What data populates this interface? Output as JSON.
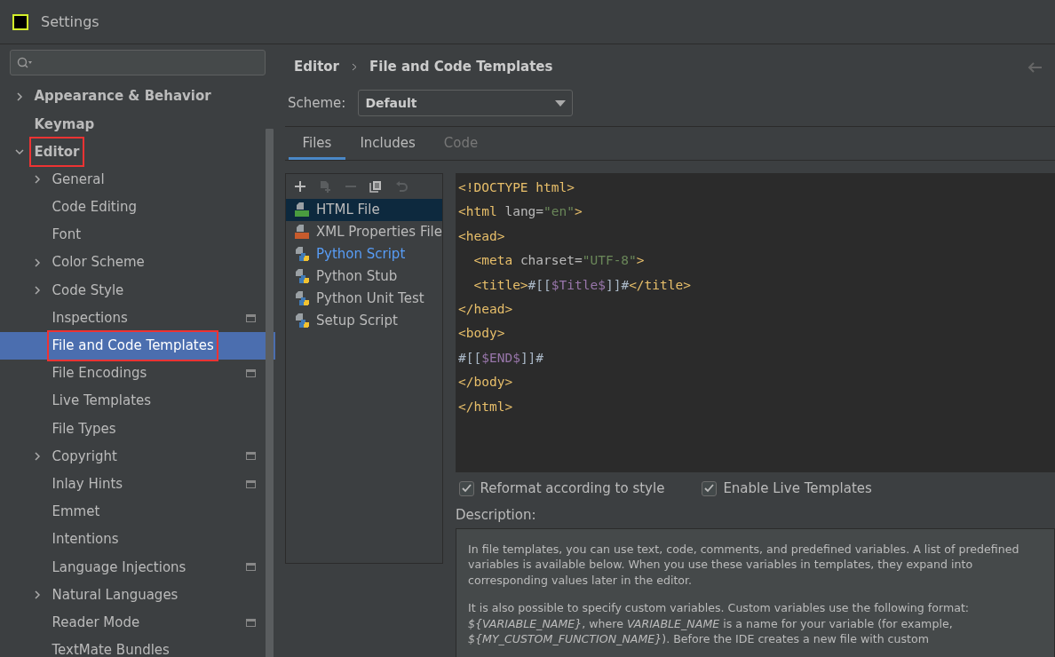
{
  "window": {
    "title": "Settings"
  },
  "sidebar": {
    "items": [
      {
        "label": "Appearance & Behavior",
        "expandable": true,
        "expanded": false,
        "selected": false,
        "highlighted": false
      },
      {
        "label": "Keymap",
        "selected": false,
        "highlighted": false
      },
      {
        "label": "Editor",
        "expandable": true,
        "expanded": true,
        "selected": false,
        "highlighted": true,
        "children": [
          {
            "label": "General",
            "expandable": true,
            "expanded": false,
            "selected": false,
            "highlighted": false
          },
          {
            "label": "Code Editing",
            "selected": false,
            "highlighted": false
          },
          {
            "label": "Font",
            "selected": false,
            "highlighted": false
          },
          {
            "label": "Color Scheme",
            "expandable": true,
            "expanded": false,
            "selected": false,
            "highlighted": false
          },
          {
            "label": "Code Style",
            "expandable": true,
            "expanded": false,
            "selected": false,
            "highlighted": false
          },
          {
            "label": "Inspections",
            "selected": false,
            "highlighted": false,
            "project_scope": true
          },
          {
            "label": "File and Code Templates",
            "selected": true,
            "highlighted": true
          },
          {
            "label": "File Encodings",
            "selected": false,
            "highlighted": false,
            "project_scope": true
          },
          {
            "label": "Live Templates",
            "selected": false,
            "highlighted": false
          },
          {
            "label": "File Types",
            "selected": false,
            "highlighted": false
          },
          {
            "label": "Copyright",
            "expandable": true,
            "expanded": false,
            "selected": false,
            "highlighted": false,
            "project_scope": true
          },
          {
            "label": "Inlay Hints",
            "selected": false,
            "highlighted": false,
            "project_scope": true
          },
          {
            "label": "Emmet",
            "selected": false,
            "highlighted": false
          },
          {
            "label": "Intentions",
            "selected": false,
            "highlighted": false
          },
          {
            "label": "Language Injections",
            "selected": false,
            "highlighted": false,
            "project_scope": true
          },
          {
            "label": "Natural Languages",
            "expandable": true,
            "expanded": false,
            "selected": false,
            "highlighted": false
          },
          {
            "label": "Reader Mode",
            "selected": false,
            "highlighted": false,
            "project_scope": true
          },
          {
            "label": "TextMate Bundles",
            "selected": false,
            "highlighted": false
          }
        ]
      }
    ]
  },
  "breadcrumb": [
    "Editor",
    "File and Code Templates"
  ],
  "scheme": {
    "label": "Scheme:",
    "value": "Default"
  },
  "tabs": [
    {
      "label": "Files",
      "selected": true,
      "disabled": false
    },
    {
      "label": "Includes",
      "selected": false,
      "disabled": false
    },
    {
      "label": "Code",
      "selected": false,
      "disabled": true
    }
  ],
  "toolbar": [
    {
      "kind": "add",
      "disabled": false
    },
    {
      "kind": "add-child",
      "disabled": true
    },
    {
      "kind": "remove",
      "disabled": true
    },
    {
      "kind": "copy",
      "disabled": false
    },
    {
      "kind": "reset",
      "disabled": true
    }
  ],
  "templates": [
    {
      "label": "HTML File",
      "kind": "html",
      "selected": true,
      "modified": false
    },
    {
      "label": "XML Properties File",
      "kind": "xml",
      "selected": false,
      "modified": false
    },
    {
      "label": "Python Script",
      "kind": "python",
      "selected": false,
      "modified": true
    },
    {
      "label": "Python Stub",
      "kind": "python",
      "selected": false,
      "modified": false
    },
    {
      "label": "Python Unit Test",
      "kind": "python",
      "selected": false,
      "modified": false
    },
    {
      "label": "Setup Script",
      "kind": "python",
      "selected": false,
      "modified": false
    }
  ],
  "code_lines": [
    [
      {
        "kind": "tag",
        "text": "<!DOCTYPE html>"
      }
    ],
    [
      {
        "kind": "tag",
        "text": "<html "
      },
      {
        "kind": "attr",
        "text": "lang="
      },
      {
        "kind": "str",
        "text": "\"en\""
      },
      {
        "kind": "tag",
        "text": ">"
      }
    ],
    [
      {
        "kind": "tag",
        "text": "<head>"
      }
    ],
    [
      {
        "kind": "tag",
        "text": "  <meta "
      },
      {
        "kind": "attr",
        "text": "charset="
      },
      {
        "kind": "str",
        "text": "\"UTF-8\""
      },
      {
        "kind": "tag",
        "text": ">"
      }
    ],
    [
      {
        "kind": "tag",
        "text": "  <title>"
      },
      {
        "kind": "text",
        "text": "#[["
      },
      {
        "kind": "var",
        "text": "$Title$"
      },
      {
        "kind": "text",
        "text": "]]#"
      },
      {
        "kind": "tag",
        "text": "</title>"
      }
    ],
    [
      {
        "kind": "tag",
        "text": "</head>"
      }
    ],
    [
      {
        "kind": "tag",
        "text": "<body>"
      }
    ],
    [
      {
        "kind": "text",
        "text": "#[["
      },
      {
        "kind": "var",
        "text": "$END$"
      },
      {
        "kind": "text",
        "text": "]]#"
      }
    ],
    [
      {
        "kind": "tag",
        "text": "</body>"
      }
    ],
    [
      {
        "kind": "tag",
        "text": "</html>"
      }
    ]
  ],
  "options": [
    {
      "label": "Reformat according to style",
      "checked": true
    },
    {
      "label": "Enable Live Templates",
      "checked": true
    }
  ],
  "description": {
    "label": "Description:",
    "paragraphs": [
      "In file templates, you can use text, code, comments, and predefined variables. A list of predefined variables is available below. When you use these variables in templates, they expand into corresponding values later in the editor.",
      "It is also possible to specify custom variables. Custom variables use the following format: *${VARIABLE_NAME}*, where *VARIABLE_NAME* is a name for your variable (for example, *${MY_CUSTOM_FUNCTION_NAME}*). Before the IDE creates a new file with custom"
    ]
  }
}
